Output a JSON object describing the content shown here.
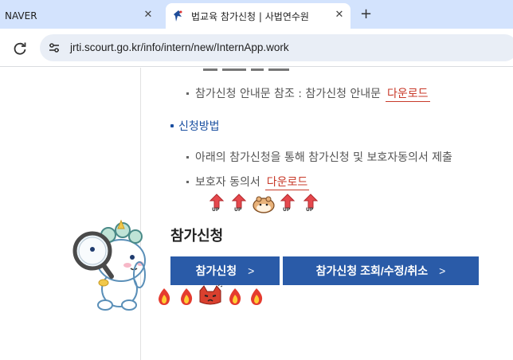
{
  "browser": {
    "tabs": [
      {
        "title": "NAVER",
        "active": false
      },
      {
        "title": "법교육 참가신청 | 사법연수원",
        "active": true
      }
    ],
    "new_tab_label": "+",
    "close_glyph": "✕",
    "url": "jrti.scourt.go.kr/info/intern/new/InternApp.work"
  },
  "content": {
    "guide_ref_label": "참가신청 안내문 참조 : 참가신청 안내문",
    "guide_download": "다운로드",
    "method_heading": "신청방법",
    "method_item": "아래의 참가신청을 통해 참가신청 및 보호자동의서 제출",
    "consent_label": "보호자 동의서",
    "consent_download": "다운로드",
    "up_label": "UP",
    "section_title": "참가신청",
    "apply_button": "참가신청",
    "lookup_button": "참가신청 조회/수정/취소",
    "chevron": ">"
  },
  "colors": {
    "accent": "#2a5ba8",
    "download": "#c83a2a",
    "tab_bar": "#d3e3fd"
  }
}
